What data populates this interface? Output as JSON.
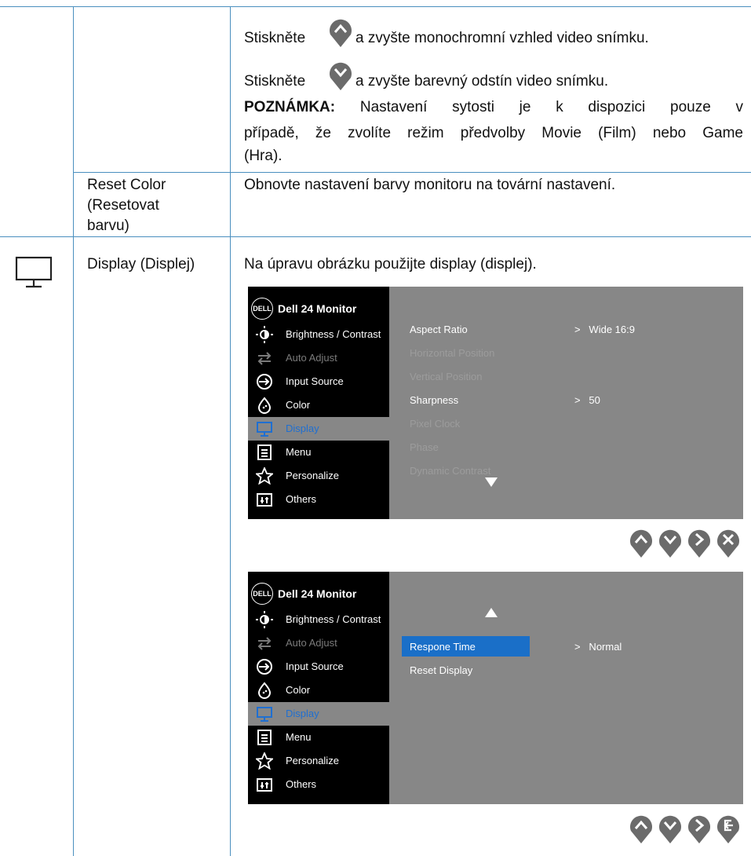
{
  "rows": {
    "saturation": {
      "line_up_prefix": "Stiskněte",
      "line_up_suffix": "a zvyšte monochromní vzhled video snímku.",
      "line_down_prefix": "Stiskněte",
      "line_down_suffix": "a zvyšte barevný odstín video snímku.",
      "note_bold": "POZNÁMKA:",
      "note_line1": "Nastavení sytosti je k dispozici pouze v",
      "note_line2": "případě, že zvolíte režim předvolby Movie (Film) nebo Game",
      "note_line3": "(Hra)."
    },
    "reset_color": {
      "label_line1": "Reset Color",
      "label_line2": "(Resetovat",
      "label_line3": "barvu)",
      "description": "Obnovte nastavení barvy monitoru na tovární nastavení."
    },
    "display": {
      "icon": "monitor-icon",
      "label": "Display (Displej)",
      "description": "Na úpravu obrázku použijte display (displej)."
    }
  },
  "osd": {
    "title": "Dell 24 Monitor",
    "logo_text": "DELL",
    "menu": [
      {
        "label": "Brightness / Contrast",
        "icon": "brightness-icon",
        "state": "normal"
      },
      {
        "label": "Auto Adjust",
        "icon": "auto-adjust-icon",
        "state": "disabled"
      },
      {
        "label": "Input Source",
        "icon": "input-source-icon",
        "state": "normal"
      },
      {
        "label": "Color",
        "icon": "color-icon",
        "state": "normal"
      },
      {
        "label": "Display",
        "icon": "display-icon",
        "state": "selected"
      },
      {
        "label": "Menu",
        "icon": "menu-icon",
        "state": "normal"
      },
      {
        "label": "Personalize",
        "icon": "star-icon",
        "state": "normal"
      },
      {
        "label": "Others",
        "icon": "others-icon",
        "state": "normal"
      }
    ],
    "screen1": {
      "options": [
        {
          "label": "Aspect Ratio",
          "value": "Wide 16:9",
          "state": "normal"
        },
        {
          "label": "Horizontal Position",
          "value": "",
          "state": "disabled"
        },
        {
          "label": "Vertical Position",
          "value": "",
          "state": "disabled"
        },
        {
          "label": "Sharpness",
          "value": "50",
          "state": "normal"
        },
        {
          "label": "Pixel Clock",
          "value": "",
          "state": "disabled"
        },
        {
          "label": "Phase",
          "value": "",
          "state": "disabled"
        },
        {
          "label": "Dynamic Contrast",
          "value": "",
          "state": "disabled"
        }
      ],
      "buttons": [
        "up-button",
        "down-button",
        "right-button",
        "exit-button"
      ]
    },
    "screen2": {
      "options": [
        {
          "label": "Respone Time",
          "value": "Normal",
          "state": "highlighted"
        },
        {
          "label": "Reset Display",
          "value": "",
          "state": "normal"
        }
      ],
      "buttons": [
        "up-button",
        "down-button",
        "right-button",
        "back-button"
      ]
    },
    "arrow_glyph": ">",
    "colors": {
      "osd_bg": "#878787",
      "sidebar": "#000000",
      "highlight": "#1a6fc8",
      "selected_text": "#1f6fd1",
      "rule": "#4a8fbf",
      "pin": "#6b6b6b"
    }
  }
}
